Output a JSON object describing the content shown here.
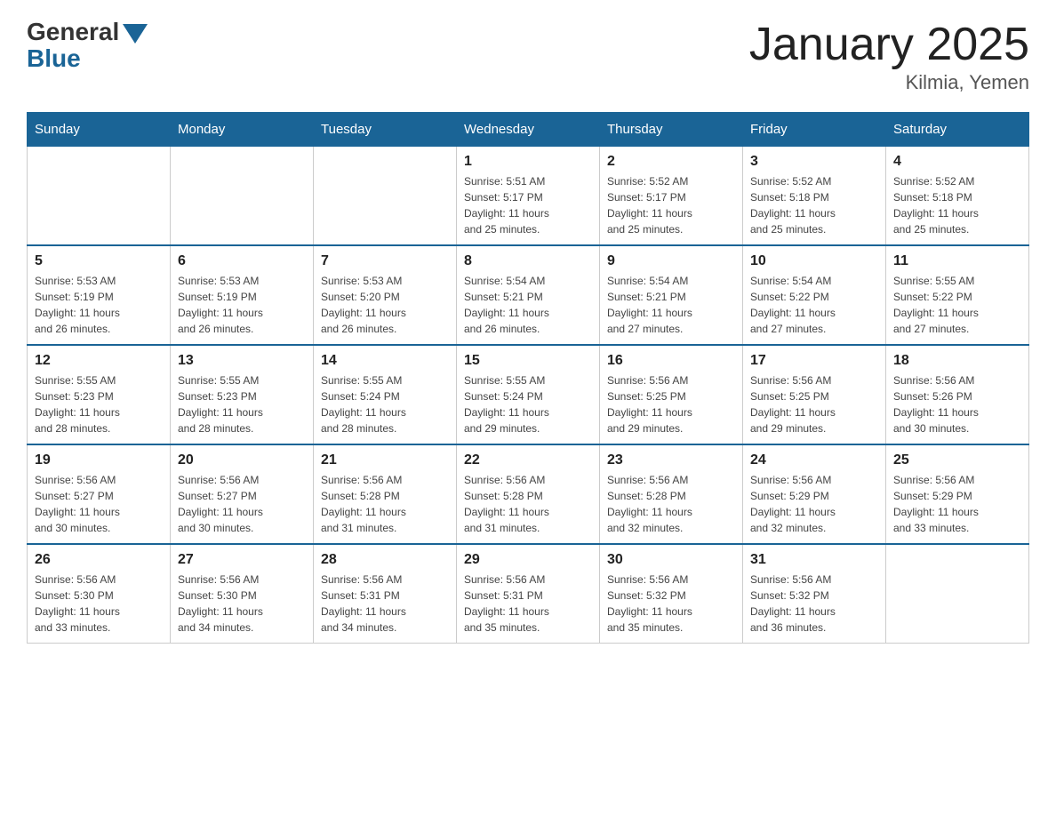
{
  "header": {
    "logo_general": "General",
    "logo_blue": "Blue",
    "title": "January 2025",
    "subtitle": "Kilmia, Yemen"
  },
  "weekdays": [
    "Sunday",
    "Monday",
    "Tuesday",
    "Wednesday",
    "Thursday",
    "Friday",
    "Saturday"
  ],
  "weeks": [
    [
      {
        "day": "",
        "info": ""
      },
      {
        "day": "",
        "info": ""
      },
      {
        "day": "",
        "info": ""
      },
      {
        "day": "1",
        "info": "Sunrise: 5:51 AM\nSunset: 5:17 PM\nDaylight: 11 hours\nand 25 minutes."
      },
      {
        "day": "2",
        "info": "Sunrise: 5:52 AM\nSunset: 5:17 PM\nDaylight: 11 hours\nand 25 minutes."
      },
      {
        "day": "3",
        "info": "Sunrise: 5:52 AM\nSunset: 5:18 PM\nDaylight: 11 hours\nand 25 minutes."
      },
      {
        "day": "4",
        "info": "Sunrise: 5:52 AM\nSunset: 5:18 PM\nDaylight: 11 hours\nand 25 minutes."
      }
    ],
    [
      {
        "day": "5",
        "info": "Sunrise: 5:53 AM\nSunset: 5:19 PM\nDaylight: 11 hours\nand 26 minutes."
      },
      {
        "day": "6",
        "info": "Sunrise: 5:53 AM\nSunset: 5:19 PM\nDaylight: 11 hours\nand 26 minutes."
      },
      {
        "day": "7",
        "info": "Sunrise: 5:53 AM\nSunset: 5:20 PM\nDaylight: 11 hours\nand 26 minutes."
      },
      {
        "day": "8",
        "info": "Sunrise: 5:54 AM\nSunset: 5:21 PM\nDaylight: 11 hours\nand 26 minutes."
      },
      {
        "day": "9",
        "info": "Sunrise: 5:54 AM\nSunset: 5:21 PM\nDaylight: 11 hours\nand 27 minutes."
      },
      {
        "day": "10",
        "info": "Sunrise: 5:54 AM\nSunset: 5:22 PM\nDaylight: 11 hours\nand 27 minutes."
      },
      {
        "day": "11",
        "info": "Sunrise: 5:55 AM\nSunset: 5:22 PM\nDaylight: 11 hours\nand 27 minutes."
      }
    ],
    [
      {
        "day": "12",
        "info": "Sunrise: 5:55 AM\nSunset: 5:23 PM\nDaylight: 11 hours\nand 28 minutes."
      },
      {
        "day": "13",
        "info": "Sunrise: 5:55 AM\nSunset: 5:23 PM\nDaylight: 11 hours\nand 28 minutes."
      },
      {
        "day": "14",
        "info": "Sunrise: 5:55 AM\nSunset: 5:24 PM\nDaylight: 11 hours\nand 28 minutes."
      },
      {
        "day": "15",
        "info": "Sunrise: 5:55 AM\nSunset: 5:24 PM\nDaylight: 11 hours\nand 29 minutes."
      },
      {
        "day": "16",
        "info": "Sunrise: 5:56 AM\nSunset: 5:25 PM\nDaylight: 11 hours\nand 29 minutes."
      },
      {
        "day": "17",
        "info": "Sunrise: 5:56 AM\nSunset: 5:25 PM\nDaylight: 11 hours\nand 29 minutes."
      },
      {
        "day": "18",
        "info": "Sunrise: 5:56 AM\nSunset: 5:26 PM\nDaylight: 11 hours\nand 30 minutes."
      }
    ],
    [
      {
        "day": "19",
        "info": "Sunrise: 5:56 AM\nSunset: 5:27 PM\nDaylight: 11 hours\nand 30 minutes."
      },
      {
        "day": "20",
        "info": "Sunrise: 5:56 AM\nSunset: 5:27 PM\nDaylight: 11 hours\nand 30 minutes."
      },
      {
        "day": "21",
        "info": "Sunrise: 5:56 AM\nSunset: 5:28 PM\nDaylight: 11 hours\nand 31 minutes."
      },
      {
        "day": "22",
        "info": "Sunrise: 5:56 AM\nSunset: 5:28 PM\nDaylight: 11 hours\nand 31 minutes."
      },
      {
        "day": "23",
        "info": "Sunrise: 5:56 AM\nSunset: 5:28 PM\nDaylight: 11 hours\nand 32 minutes."
      },
      {
        "day": "24",
        "info": "Sunrise: 5:56 AM\nSunset: 5:29 PM\nDaylight: 11 hours\nand 32 minutes."
      },
      {
        "day": "25",
        "info": "Sunrise: 5:56 AM\nSunset: 5:29 PM\nDaylight: 11 hours\nand 33 minutes."
      }
    ],
    [
      {
        "day": "26",
        "info": "Sunrise: 5:56 AM\nSunset: 5:30 PM\nDaylight: 11 hours\nand 33 minutes."
      },
      {
        "day": "27",
        "info": "Sunrise: 5:56 AM\nSunset: 5:30 PM\nDaylight: 11 hours\nand 34 minutes."
      },
      {
        "day": "28",
        "info": "Sunrise: 5:56 AM\nSunset: 5:31 PM\nDaylight: 11 hours\nand 34 minutes."
      },
      {
        "day": "29",
        "info": "Sunrise: 5:56 AM\nSunset: 5:31 PM\nDaylight: 11 hours\nand 35 minutes."
      },
      {
        "day": "30",
        "info": "Sunrise: 5:56 AM\nSunset: 5:32 PM\nDaylight: 11 hours\nand 35 minutes."
      },
      {
        "day": "31",
        "info": "Sunrise: 5:56 AM\nSunset: 5:32 PM\nDaylight: 11 hours\nand 36 minutes."
      },
      {
        "day": "",
        "info": ""
      }
    ]
  ]
}
